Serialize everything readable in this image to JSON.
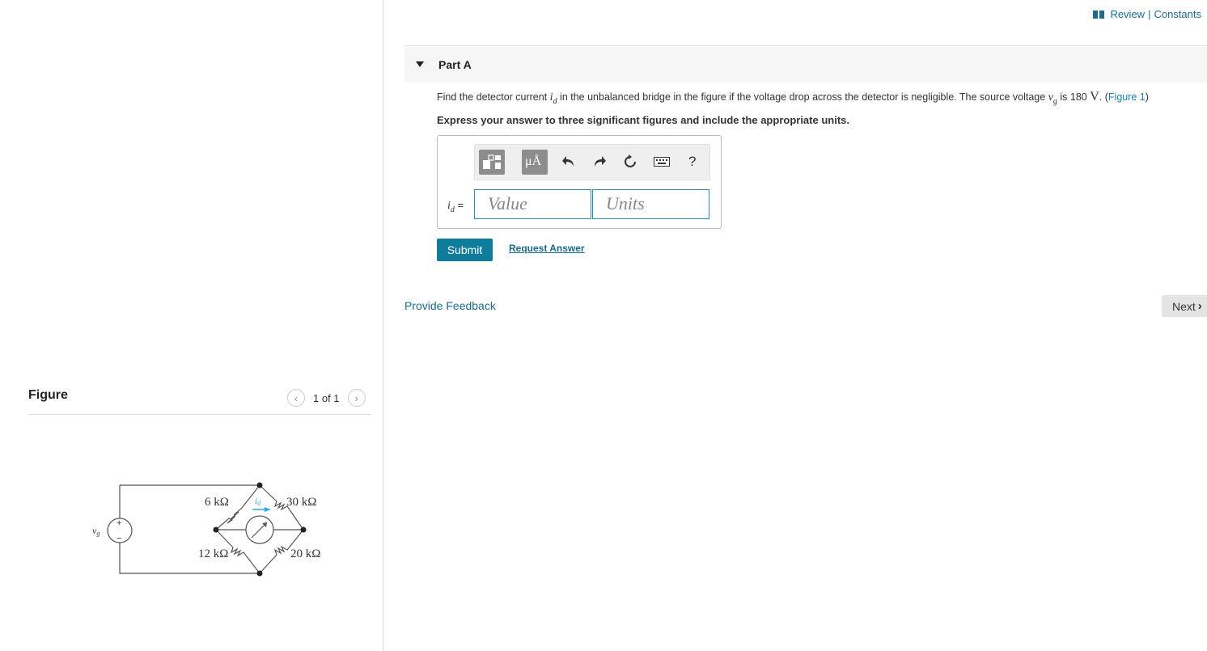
{
  "header": {
    "review_label": "Review",
    "separator": "|",
    "constants_label": "Constants"
  },
  "part": {
    "title": "Part A"
  },
  "question": {
    "text_before": "Find the detector current",
    "var_current": "i",
    "var_current_sub": "d",
    "text_middle": "in the unbalanced bridge in the figure if the voltage drop across the detector is negligible. The source voltage",
    "var_voltage": "v",
    "var_voltage_sub": "g",
    "text_is": "is 180",
    "unit": "V",
    "figure_link": "Figure 1"
  },
  "instruction": "Express your answer to three significant figures and include the appropriate units.",
  "answer": {
    "label_var": "i",
    "label_sub": "d",
    "label_eq": "=",
    "value_placeholder": "Value",
    "units_placeholder": "Units"
  },
  "toolbar": {
    "units_btn": "μÅ",
    "help": "?"
  },
  "actions": {
    "submit": "Submit",
    "request_answer": "Request Answer"
  },
  "feedback": "Provide Feedback",
  "next": "Next",
  "figure": {
    "title": "Figure",
    "page_indicator": "1 of 1",
    "circuit": {
      "r_top_left": "6 kΩ",
      "r_top_right": "30 kΩ",
      "r_bottom_left": "12 kΩ",
      "r_bottom_right": "20 kΩ",
      "source_label": "v",
      "source_sub": "g",
      "current_label": "i",
      "current_sub": "d",
      "plus": "+",
      "minus": "−"
    }
  },
  "colors": {
    "link": "#1a6b8f",
    "submit_bg": "#0f7c9c",
    "current_arrow": "#29a8e0",
    "divider": "#c8dce6"
  }
}
